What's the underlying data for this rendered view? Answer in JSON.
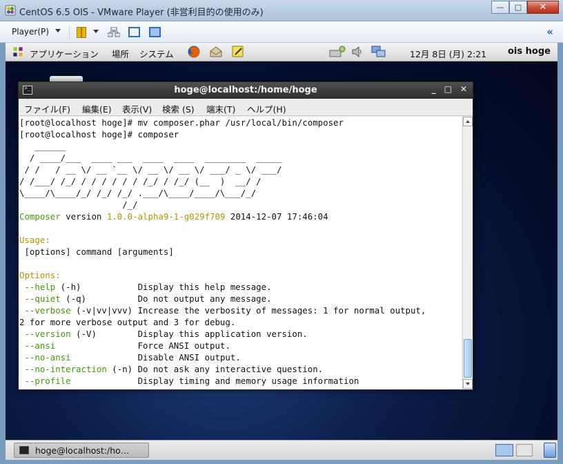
{
  "window": {
    "title": "CentOS 6.5 OIS - VMware Player (非営利目的の使用のみ)",
    "controls": {
      "minimize": "—",
      "maximize": "□",
      "close": "✕"
    }
  },
  "vm_toolbar": {
    "player_menu": "Player(P)",
    "collapse": "«"
  },
  "gnome_panel": {
    "menus": [
      "アプリケーション",
      "場所",
      "システム"
    ],
    "clock": "12月 8日 (月)  2:21",
    "user": "ois hoge"
  },
  "terminal": {
    "title": "hoge@localhost:/home/hoge",
    "menu": [
      "ファイル(F)",
      "編集(E)",
      "表示(V)",
      "検索 (S)",
      "端末(T)",
      "ヘルプ(H)"
    ],
    "lines": [
      [
        {
          "t": "[root@localhost hoge]# mv composer.phar /usr/local/bin/composer"
        }
      ],
      [
        {
          "t": "[root@localhost hoge]# composer"
        }
      ],
      [
        {
          "t": "   ______"
        }
      ],
      [
        {
          "t": "  / ____/___  ____ ___  ____  ____  ________  _____"
        }
      ],
      [
        {
          "t": " / /   / __ \\/ __ `__ \\/ __ \\/ __ \\/ ___/ _ \\/ ___/"
        }
      ],
      [
        {
          "t": "/ /___/ /_/ / / / / / / /_/ / /_/ (__  )  __/ /"
        }
      ],
      [
        {
          "t": "\\____/\\____/_/ /_/ /_/ .___/\\____/____/\\___/_/"
        }
      ],
      [
        {
          "t": "                    /_/"
        }
      ],
      [
        {
          "t": "Composer",
          "c": "g"
        },
        {
          "t": " version "
        },
        {
          "t": "1.0.0-alpha9-1-g029f709",
          "c": "y"
        },
        {
          "t": " 2014-12-07 17:46:04"
        }
      ],
      [
        {
          "t": ""
        }
      ],
      [
        {
          "t": "Usage:",
          "c": "y"
        }
      ],
      [
        {
          "t": " [options] command [arguments]"
        }
      ],
      [
        {
          "t": ""
        }
      ],
      [
        {
          "t": "Options:",
          "c": "y"
        }
      ],
      [
        {
          "t": " --help",
          "c": "g"
        },
        {
          "t": " (-h)           Display this help message."
        }
      ],
      [
        {
          "t": " --quiet",
          "c": "g"
        },
        {
          "t": " (-q)          Do not output any message."
        }
      ],
      [
        {
          "t": " --verbose",
          "c": "g"
        },
        {
          "t": " (-v|vv|vvv) Increase the verbosity of messages: 1 for normal output,"
        }
      ],
      [
        {
          "t": "2 for more verbose output and 3 for debug."
        }
      ],
      [
        {
          "t": " --version",
          "c": "g"
        },
        {
          "t": " (-V)        Display this application version."
        }
      ],
      [
        {
          "t": " --ansi",
          "c": "g"
        },
        {
          "t": "                Force ANSI output."
        }
      ],
      [
        {
          "t": " --no-ansi",
          "c": "g"
        },
        {
          "t": "             Disable ANSI output."
        }
      ],
      [
        {
          "t": " --no-interaction",
          "c": "g"
        },
        {
          "t": " (-n) Do not ask any interactive question."
        }
      ],
      [
        {
          "t": " --profile",
          "c": "g"
        },
        {
          "t": "             Display timing and memory usage information"
        }
      ]
    ]
  },
  "taskbar": {
    "task_label": "hoge@localhost:/ho…"
  },
  "colors": {
    "terminal_green": "#3e9a06",
    "terminal_yellow": "#b29400",
    "desktop_blue": "#0b1c47"
  }
}
